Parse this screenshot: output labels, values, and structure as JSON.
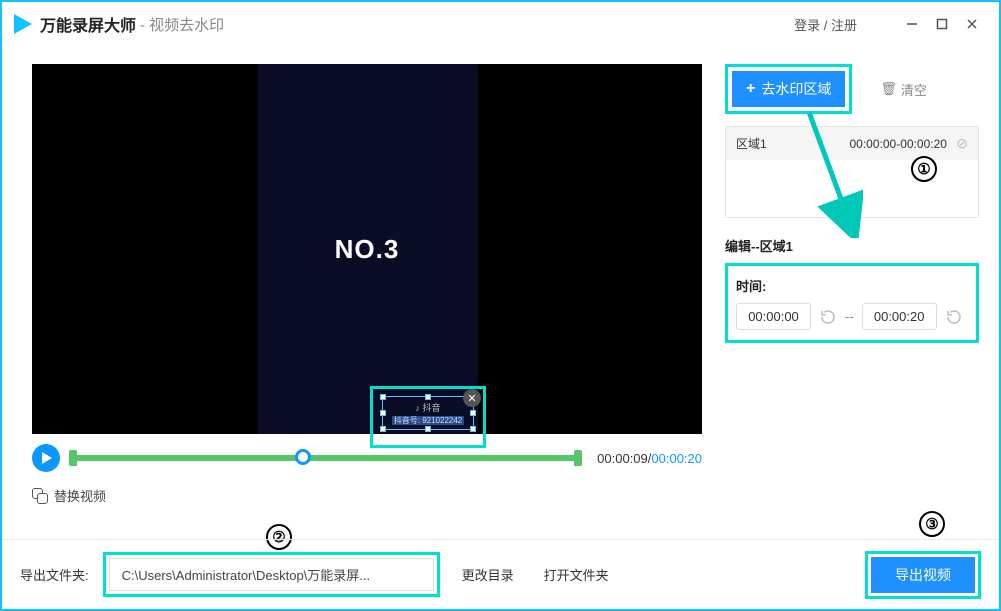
{
  "app_name": "万能录屏大师",
  "page_suffix": " - 视频去水印",
  "auth_link": "登录 / 注册",
  "video": {
    "center_text": "NO.3",
    "watermark_line1": "♪ 抖音",
    "watermark_line2": "抖音号: 921022242"
  },
  "player": {
    "current": "00:00:09",
    "total": "00:00:20"
  },
  "replace_video": "替换视频",
  "sidebar": {
    "add_label": "去水印区域",
    "clear_label": "清空",
    "region_name": "区域1",
    "region_time": "00:00:00-00:00:20",
    "edit_title": "编辑--区域1",
    "time_label": "时间:",
    "time_start": "00:00:00",
    "time_end": "00:00:20"
  },
  "annotations": {
    "n1": "①",
    "n2": "②",
    "n3": "③"
  },
  "footer": {
    "out_label": "导出文件夹:",
    "path": "C:\\Users\\Administrator\\Desktop\\万能录屏...",
    "change_dir": "更改目录",
    "open_dir": "打开文件夹",
    "export": "导出视频"
  }
}
